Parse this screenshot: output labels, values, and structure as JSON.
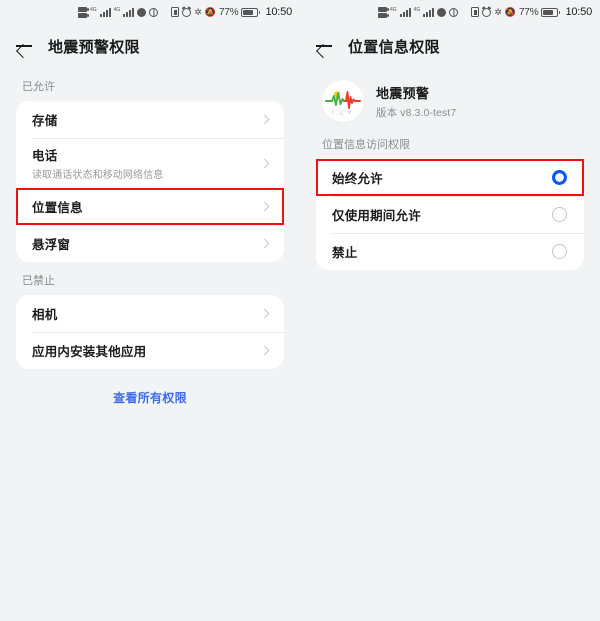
{
  "statusbar": {
    "battery_percent": "77%",
    "time": "10:50",
    "icons": [
      "sim-dual-icon",
      "signal-bars-icon",
      "signal-bars-icon",
      "no-sound-icon",
      "globe-icon",
      "vibrate-icon",
      "alarm-icon",
      "bluetooth-icon",
      "mute-bell-icon",
      "battery-icon"
    ]
  },
  "left": {
    "appbar": {
      "title": "地震预警权限",
      "back": "back-arrow"
    },
    "sections": [
      {
        "label": "已允许",
        "rows": [
          {
            "title": "存储",
            "sub": ""
          },
          {
            "title": "电话",
            "sub": "读取通话状态和移动网络信息"
          },
          {
            "title": "位置信息",
            "sub": "",
            "highlight": true
          },
          {
            "title": "悬浮窗",
            "sub": ""
          }
        ]
      },
      {
        "label": "已禁止",
        "rows": [
          {
            "title": "相机",
            "sub": ""
          },
          {
            "title": "应用内安装其他应用",
            "sub": ""
          }
        ]
      }
    ],
    "link_all": "查看所有权限"
  },
  "right": {
    "appbar": {
      "title": "位置信息权限",
      "back": "back-arrow"
    },
    "app": {
      "name": "地震预警",
      "version": "版本 v8.3.0-test7",
      "icon": "earthquake-wave-icon"
    },
    "section_label": "位置信息访问权限",
    "options": [
      {
        "label": "始终允许",
        "selected": true,
        "highlight": true
      },
      {
        "label": "仅使用期间允许",
        "selected": false
      },
      {
        "label": "禁止",
        "selected": false
      }
    ]
  },
  "colors": {
    "accent_blue": "#0a59f7",
    "link_blue": "#3e6bf0",
    "highlight_red": "#ee1111",
    "page_bg": "#f1f3f4",
    "card_bg": "#ffffff"
  }
}
